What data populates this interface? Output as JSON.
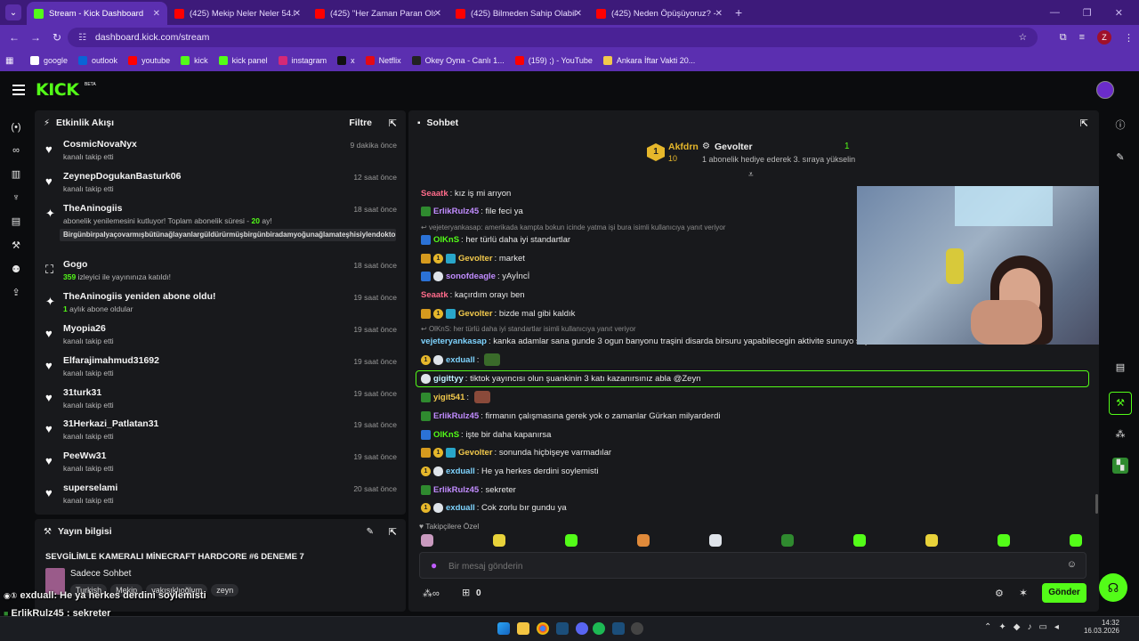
{
  "browser": {
    "tabs": [
      {
        "title": "Stream - Kick Dashboard",
        "fav": "#53fc18",
        "active": true
      },
      {
        "title": "(425) Mekip Neler Neler 54.Böl",
        "fav": "#ff0000",
        "active": false
      },
      {
        "title": "(425) \"Her Zaman Paran Olsun",
        "fav": "#ff0000",
        "active": false
      },
      {
        "title": "(425) Bilmeden Sahip Olabilece",
        "fav": "#ff0000",
        "active": false
      },
      {
        "title": "(425) Neden Öpüşüyoruz? - Yo",
        "fav": "#ff0000",
        "active": false
      }
    ],
    "url": "dashboard.kick.com/stream",
    "profile_initial": "Z",
    "bookmarks": [
      {
        "label": "google",
        "color": "#ffffff"
      },
      {
        "label": "outlook",
        "color": "#0a64d6"
      },
      {
        "label": "youtube",
        "color": "#ff0000"
      },
      {
        "label": "kick",
        "color": "#53fc18"
      },
      {
        "label": "kick panel",
        "color": "#53fc18"
      },
      {
        "label": "instagram",
        "color": "#d62976"
      },
      {
        "label": "x",
        "color": "#111111"
      },
      {
        "label": "Netflix",
        "color": "#e50914"
      },
      {
        "label": "Okey Oyna - Canlı 1...",
        "color": "#222222"
      },
      {
        "label": "(159) ;) - YouTube",
        "color": "#ff0000"
      },
      {
        "label": "Ankara İftar Vakti 20...",
        "color": "#f2c94c"
      }
    ]
  },
  "kick": {
    "logo": "KICK",
    "beta": "BETA"
  },
  "activity": {
    "title": "Etkinlik Akışı",
    "filter_label": "Filtre",
    "items": [
      {
        "icon": "heart",
        "name": "CosmicNovaNyx",
        "sub": "kanalı takip etti",
        "time": "9 dakika önce"
      },
      {
        "icon": "heart",
        "name": "ZeynepDogukanBasturk06",
        "sub": "kanalı takip etti",
        "time": "12 saat önce"
      },
      {
        "icon": "star",
        "name": "TheAninogiis",
        "sub_pre": "abonelik yenilemesini kutluyor! Toplam abonelik süresi - ",
        "sub_num": "20",
        "sub_post": " ay!",
        "message": "Birgünbirpalyaçovarmışbütünağlayanlargüldürürmüşbirgünbiradamyoğunağlamateşhisiylendoktora",
        "time": "18 saat önce"
      },
      {
        "icon": "raid",
        "name": "Gogo",
        "sub_num": "359",
        "sub_post": " izleyici ile yayınınıza katıldı!",
        "time": "18 saat önce"
      },
      {
        "icon": "star",
        "name": "TheAninogiis yeniden abone oldu!",
        "sub_num": "1",
        "sub_post": " aylık abone oldular",
        "time": "19 saat önce"
      },
      {
        "icon": "heart",
        "name": "Myopia26",
        "sub": "kanalı takip etti",
        "time": "19 saat önce"
      },
      {
        "icon": "heart",
        "name": "Elfarajimahmud31692",
        "sub": "kanalı takip etti",
        "time": "19 saat önce"
      },
      {
        "icon": "heart",
        "name": "31turk31",
        "sub": "kanalı takip etti",
        "time": "19 saat önce"
      },
      {
        "icon": "heart",
        "name": "31Herkazi_Patlatan31",
        "sub": "kanalı takip etti",
        "time": "19 saat önce"
      },
      {
        "icon": "heart",
        "name": "PeeWw31",
        "sub": "kanalı takip etti",
        "time": "19 saat önce"
      },
      {
        "icon": "heart",
        "name": "superselami",
        "sub": "kanalı takip etti",
        "time": "20 saat önce"
      }
    ]
  },
  "stream_info": {
    "title": "Yayın bilgisi",
    "stream_title": "SEVGİLİMLE KAMERALI MİNECRAFT HARDCORE #6 DENEME 7",
    "category": "Sadece Sohbet",
    "tags": [
      "Turkish",
      "Mekip",
      "yakışıklıoğlum",
      "zeyn"
    ]
  },
  "overlay": {
    "line1_user": "exduall",
    "line1_text": ": He ya herkes derdini soylemisti",
    "line2_user": "ErlikRulz45",
    "line2_text": " : sekreter"
  },
  "chat": {
    "title": "Sohbet",
    "pinned": {
      "top_user": "Akfdrn",
      "top_count": "10",
      "gifter": "Gevolter",
      "gifter_count": "1",
      "gifter_msg": "1 abonelik hediye ederek 3. sıraya yükselin"
    },
    "messages": [
      {
        "user": "Seaatk",
        "color": "#ff6b8a",
        "badges": [],
        "text": "kız iş mi arıyon"
      },
      {
        "user": "ErlikRulz45",
        "color": "#c18cff",
        "badges": [
          "frog"
        ],
        "text": "file feci ya"
      },
      {
        "reply": "vejeteryankasap: amerikada kampta bokun icinde yatma işi bura isimli kullanıcıya yanıt veriyor"
      },
      {
        "user": "OlKnS",
        "color": "#53fc18",
        "badges": [
          "blue"
        ],
        "text": "her türlü daha iyi standartlar"
      },
      {
        "user": "Gevolter",
        "color": "#f2c94c",
        "badges": [
          "crown",
          "one",
          "gift"
        ],
        "text": "market"
      },
      {
        "user": "sonofdeagle",
        "color": "#c18cff",
        "badges": [
          "blue",
          "ghost"
        ],
        "text": "yAyİncİ"
      },
      {
        "user": "Seaatk",
        "color": "#ff6b8a",
        "badges": [],
        "text": "kaçırdım orayı ben"
      },
      {
        "user": "Gevolter",
        "color": "#f2c94c",
        "badges": [
          "crown",
          "one",
          "gift"
        ],
        "text": "bizde mal gibi kaldık"
      },
      {
        "reply": "OlKnS: her türlü daha iyi standartlar isimli kullanıcıya yanıt veriyor"
      },
      {
        "user": "vejeteryankasap",
        "color": "#7fd4ff",
        "badges": [],
        "text": "kanka adamlar sana gunde 3 ogun banyonu traşini disarda birsuru yapabilecegin aktivite sunuyo super"
      },
      {
        "user": "exduall",
        "color": "#7fd4ff",
        "badges": [
          "one",
          "ghost"
        ],
        "text": "",
        "emote": "#3a6b2a"
      },
      {
        "user": "gigittyy",
        "color": "#c0f0ff",
        "badges": [
          "ghost"
        ],
        "text": "tiktok yayıncısı olun şuankinin 3 katı kazanırsınız abla @Zeyn",
        "highlight": true
      },
      {
        "user": "yigit541",
        "color": "#f2c94c",
        "badges": [
          "frog"
        ],
        "text": "",
        "emote": "#8a4a3a"
      },
      {
        "user": "ErlikRulz45",
        "color": "#c18cff",
        "badges": [
          "frog"
        ],
        "text": "firmanın çalışmasına gerek yok o zamanlar Gürkan milyarderdi"
      },
      {
        "user": "OlKnS",
        "color": "#53fc18",
        "badges": [
          "blue"
        ],
        "text": "işte bir daha kapanırsa"
      },
      {
        "user": "Gevolter",
        "color": "#f2c94c",
        "badges": [
          "crown",
          "one",
          "gift"
        ],
        "text": "sonunda hiçbişeye varmadılar"
      },
      {
        "user": "exduall",
        "color": "#7fd4ff",
        "badges": [
          "one",
          "ghost"
        ],
        "text": "He ya herkes derdini soylemisti"
      },
      {
        "user": "ErlikRulz45",
        "color": "#c18cff",
        "badges": [
          "frog"
        ],
        "text": "sekreter"
      },
      {
        "user": "exduall",
        "color": "#7fd4ff",
        "badges": [
          "one",
          "ghost"
        ],
        "text": "Cok zorlu bır gundu ya"
      }
    ],
    "emote_tray_label": "Takipçilere Özel",
    "input_placeholder": "Bir mesaj gönderin",
    "points_count": "0",
    "send_label": "Gönder"
  },
  "taskbar": {
    "time": "14:32",
    "date": "16.03.2026"
  }
}
